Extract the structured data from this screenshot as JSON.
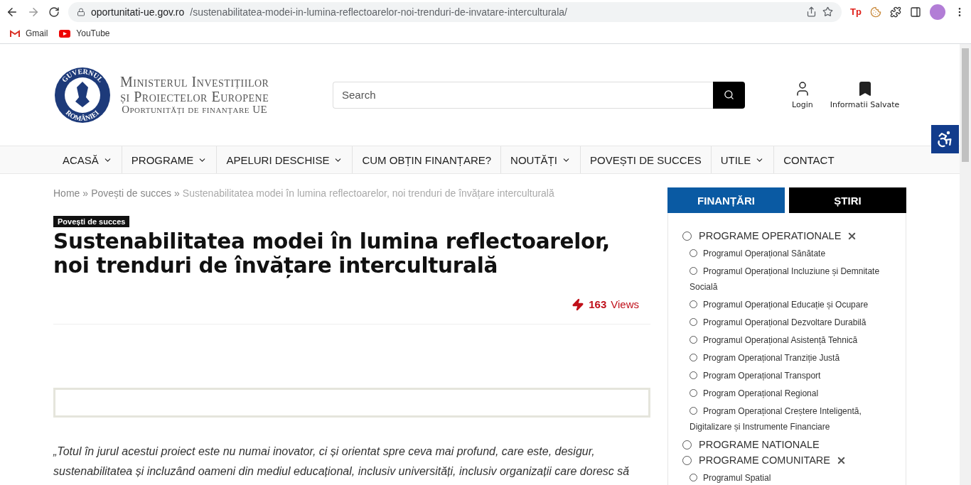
{
  "browser": {
    "url_host": "oportunitati-ue.gov.ro",
    "url_path": "/sustenabilitatea-modei-in-lumina-reflectoarelor-noi-trenduri-de-invatare-interculturala/",
    "extension_badge": "Tp",
    "bookmarks": [
      {
        "label": "Gmail",
        "kind": "gmail"
      },
      {
        "label": "YouTube",
        "kind": "youtube"
      }
    ]
  },
  "header": {
    "logo_lines": [
      "Ministerul Investițiilor",
      "și Proiectelor Europene",
      "Oportunități de finanțare UE"
    ],
    "seal_top": "GUVERNUL",
    "seal_bottom": "ROMÂNIEI",
    "search": {
      "placeholder": "Search"
    },
    "login": "Login",
    "saved": "Informatii Salvate"
  },
  "nav": [
    {
      "label": "ACASĂ",
      "dropdown": true
    },
    {
      "label": "PROGRAME",
      "dropdown": true
    },
    {
      "label": "APELURI DESCHISE",
      "dropdown": true
    },
    {
      "label": "CUM OBȚIN FINANȚARE?",
      "dropdown": false
    },
    {
      "label": "NOUTĂȚI",
      "dropdown": true
    },
    {
      "label": "POVEȘTI DE SUCCES",
      "dropdown": false
    },
    {
      "label": "UTILE",
      "dropdown": true
    },
    {
      "label": "CONTACT",
      "dropdown": false
    }
  ],
  "breadcrumb": [
    {
      "label": "Home",
      "current": false
    },
    {
      "label": "Povești de succes",
      "current": false
    },
    {
      "label": "Sustenabilitatea modei în lumina reflectoarelor, noi trenduri de învățare interculturală",
      "current": true
    }
  ],
  "breadcrumb_separator": "»",
  "article": {
    "category": "Povești de succes",
    "title": "Sustenabilitatea modei în lumina reflectoarelor, noi trenduri de învățare interculturală",
    "views_count": "163",
    "views_label": "Views",
    "quote": "„Totul în jurul acestui proiect este nu numai inovator, ci și orientat spre ceva mai profund, care este, desigur, sustenabilitatea și incluzând oameni din mediul educațional, inclusiv universități, inclusiv organizații care doresc să"
  },
  "sidebar": {
    "tabs": [
      {
        "label": "FINANȚĂRI",
        "selected": true
      },
      {
        "label": "ȘTIRI",
        "selected": false
      }
    ],
    "tree": [
      {
        "label": "PROGRAME OPERATIONALE",
        "checked": false,
        "expanded": true,
        "children": [
          {
            "label": "Programul Operațional Sănătate",
            "checked": false
          },
          {
            "label": "Programul Operațional Incluziune și Demnitate Socială",
            "checked": false
          },
          {
            "label": "Programul Operațional Educație și Ocupare",
            "checked": false
          },
          {
            "label": "Programul Operațional Dezvoltare Durabilă",
            "checked": false
          },
          {
            "label": "Programul Operațional Asistență Tehnică",
            "checked": false
          },
          {
            "label": "Program Operațional Tranziție Justă",
            "checked": false
          },
          {
            "label": "Program Operațional Transport",
            "checked": false
          },
          {
            "label": "Program Operațional Regional",
            "checked": false
          },
          {
            "label": "Program Operațional Creștere Inteligentă, Digitalizare și Instrumente Financiare",
            "checked": false
          }
        ]
      },
      {
        "label": "PROGRAME NATIONALE",
        "checked": false,
        "expanded": false
      },
      {
        "label": "PROGRAME COMUNITARE",
        "checked": false,
        "expanded": true,
        "children": [
          {
            "label": "Programul Spatial",
            "checked": false
          }
        ]
      }
    ]
  }
}
